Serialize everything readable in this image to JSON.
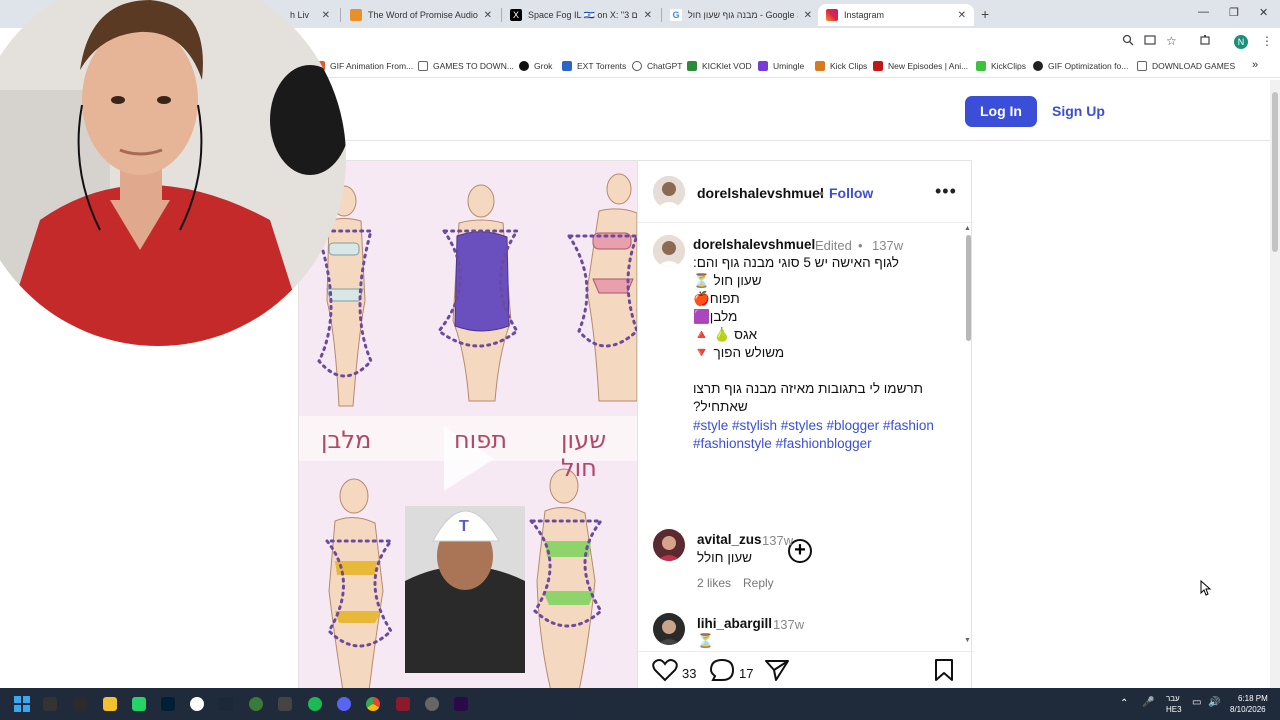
{
  "browser": {
    "tabs": [
      {
        "title": "h Liv",
        "favicon_color": "#c0c0c0",
        "active": false
      },
      {
        "title": "The Word of Promise Audio Bi",
        "favicon_color": "#e8912a",
        "active": false
      },
      {
        "title": "Space Fog IL 🇮🇱 on X: \"3 כוחניום",
        "favicon_color": "#000000",
        "active": false
      },
      {
        "title": "מבנה גוף שעון חול - Google Search",
        "favicon_color": "#4285f4",
        "active": false
      },
      {
        "title": "Instagram",
        "favicon_color": "#d6249f",
        "active": true
      }
    ],
    "tab_close": "✕",
    "new_tab": "+",
    "window_controls": {
      "minimize": "—",
      "restore": "❐",
      "close": "✕"
    },
    "profile_initial": "N",
    "bookmarks": [
      {
        "label": "GIF Animation From...",
        "color": "#e05a2a"
      },
      {
        "label": "GAMES TO DOWN...",
        "color": "#666666"
      },
      {
        "label": "Grok",
        "color": "#111111"
      },
      {
        "label": "EXT Torrents",
        "color": "#2a66c8"
      },
      {
        "label": "ChatGPT",
        "color": "#555555"
      },
      {
        "label": "KICKlet VOD",
        "color": "#2c8a3a"
      },
      {
        "label": "Umingle",
        "color": "#7a3ad6"
      },
      {
        "label": "Kick Clips",
        "color": "#d87a20"
      },
      {
        "label": "New Episodes | Ani...",
        "color": "#c01818"
      },
      {
        "label": "KickClips",
        "color": "#3ec23e"
      },
      {
        "label": "GIF Optimization fo...",
        "color": "#222222"
      },
      {
        "label": "DOWNLOAD GAMES",
        "color": "#666666"
      }
    ],
    "bookmarks_more": "»"
  },
  "instagram": {
    "header": {
      "login": "Log In",
      "signup": "Sign Up"
    },
    "post": {
      "username": "dorelshalevshmuel",
      "follow": "Follow",
      "more": "•••",
      "media_labels": [
        "מלבן",
        "תפוח",
        "שעון חול"
      ],
      "caption": {
        "username": "dorelshalevshmuel",
        "edited": "Edited",
        "bullet": "•",
        "age": "137w",
        "lines": [
          "לגוף האישה יש 5 סוגי מבנה גוף והם:",
          "שעון חול ⏳",
          "תפוח🍎",
          "מלבן🟪",
          "אגס 🍐 🔺",
          "משולש הפוך 🔻",
          "תרשמו לי בתגובות מאיזה מבנה גוף תרצו",
          "שאתחיל?"
        ],
        "hashtags": "#style #stylish #styles #blogger #fashion #fashionstyle #fashionblogger"
      },
      "load_more": "+",
      "comments": [
        {
          "username": "avital_zus",
          "age": "137w",
          "text": "שעון חולל",
          "likes": "2 likes",
          "reply": "Reply"
        },
        {
          "username": "lihi_abargill",
          "age": "137w",
          "text": "⏳",
          "likes": "",
          "reply": ""
        }
      ],
      "actions": {
        "likes": "33",
        "comments": "17"
      }
    }
  },
  "taskbar": {
    "lang": "עבר",
    "lang2": "HE3",
    "time": "6:18 PM",
    "date": "8/10/2026"
  }
}
